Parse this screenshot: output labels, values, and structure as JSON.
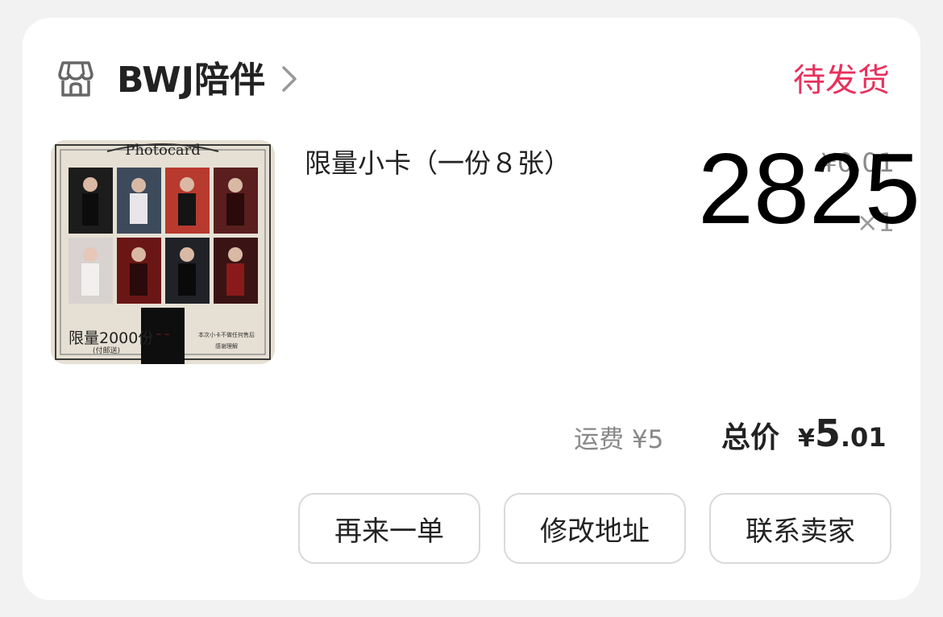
{
  "store": {
    "icon": "store-icon",
    "name": "BWJ陪伴",
    "chevron_icon": "chevron-right-icon"
  },
  "order": {
    "status": "待发货",
    "status_color": "#e8315c"
  },
  "product": {
    "title": "限量小卡（一份８张）",
    "thumbnail": {
      "header_text": "Photocard",
      "limited_text": "限量2000份",
      "sub_text": "(付邮送)",
      "note_line1": "本次小卡不做任何售后",
      "note_line2": "感谢理解"
    },
    "unit_price": "¥0.01",
    "quantity": "×1"
  },
  "overlay_number": "2825",
  "summary": {
    "shipping_label": "运费",
    "shipping_value": "¥5",
    "total_label": "总价",
    "total_currency": "¥",
    "total_integer": "5",
    "total_decimal": ".01"
  },
  "actions": {
    "reorder": "再来一单",
    "edit_address": "修改地址",
    "contact_seller": "联系卖家"
  }
}
